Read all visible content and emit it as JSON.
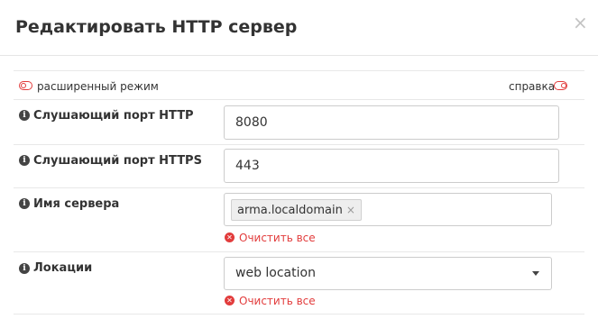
{
  "dialog": {
    "title": "Редактировать HTTP сервер",
    "close_glyph": "×"
  },
  "toolbar": {
    "advanced_mode_label": "расширенный режим",
    "help_label": "справка"
  },
  "fields": {
    "http_port": {
      "label": "Слушающий порт HTTP",
      "value": "8080"
    },
    "https_port": {
      "label": "Слушающий порт HTTPS",
      "value": "443"
    },
    "server_name": {
      "label": "Имя сервера",
      "chip": "arma.localdomain",
      "chip_remove": "×",
      "clear_label": "Очистить все"
    },
    "locations": {
      "label": "Локации",
      "selected": "web location",
      "clear_label": "Очистить все"
    }
  },
  "icons": {
    "info": "info-icon",
    "clear": "clear-icon",
    "toggle": "toggle-icon",
    "caret": "chevron-down-icon"
  },
  "colors": {
    "accent_red": "#e23c3c",
    "border": "#cccccc",
    "text": "#333333"
  }
}
